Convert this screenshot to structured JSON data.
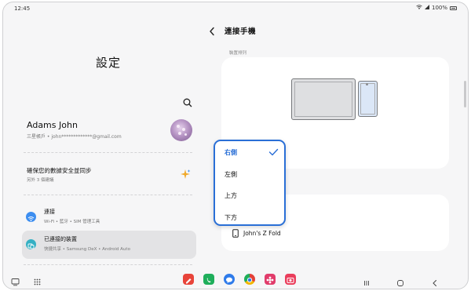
{
  "status_bar": {
    "time": "12:45",
    "battery": "100%"
  },
  "left_pane": {
    "title": "設定",
    "account": {
      "name": "Adams John",
      "subtitle": "三星帳戶 • john*************@gmail.com"
    },
    "security": {
      "title": "確保您的數據安全並同步",
      "subtitle": "另外 3 個建議"
    },
    "items": [
      {
        "title": "連接",
        "subtitle": "Wi-Fi • 藍牙 • SIM 管理工具",
        "icon": "wifi-icon",
        "color": "#3d8ef0"
      },
      {
        "title": "已連接的裝置",
        "subtitle": "快捷共享 • Samsung DeX • Android Auto",
        "icon": "connected-devices-icon",
        "color": "#35b0c4"
      }
    ]
  },
  "right_pane": {
    "title": "連接手機",
    "arrangement_label": "裝置排列",
    "device_name": "John's Z Fold"
  },
  "popup": {
    "options": [
      "右側",
      "左側",
      "上方",
      "下方"
    ],
    "selected": "右側",
    "accent": "#2a6fd6"
  },
  "taskbar": {
    "apps": [
      {
        "name": "notes-app-icon",
        "color": "#e8443a"
      },
      {
        "name": "phone-app-icon",
        "color": "#1fae5b"
      },
      {
        "name": "messages-app-icon",
        "color": "#2f7bea"
      },
      {
        "name": "chrome-app-icon",
        "color": "#f2b600"
      },
      {
        "name": "gallery-app-icon",
        "color": "#e13c6b"
      },
      {
        "name": "camera-app-icon",
        "color": "#ea3e5c"
      }
    ]
  }
}
